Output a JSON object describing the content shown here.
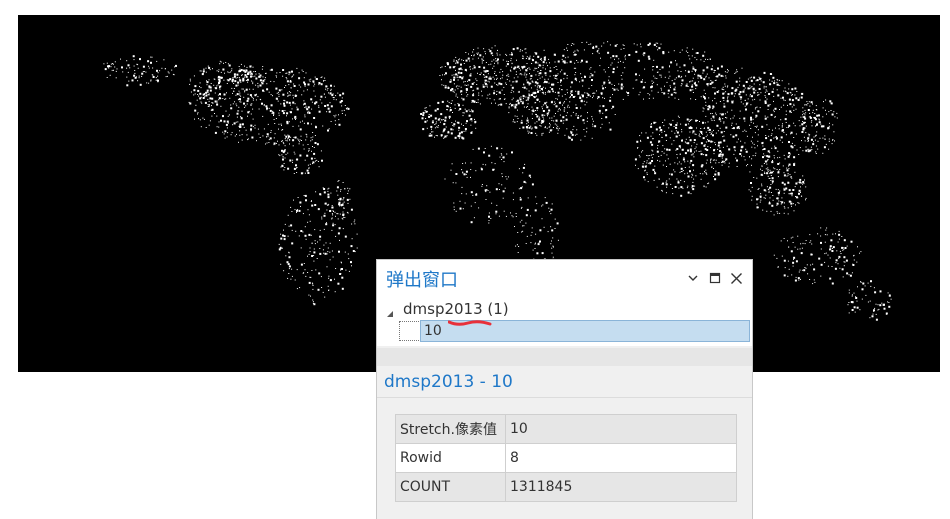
{
  "map": {
    "background": "#000000",
    "lights_color": "#ffffff"
  },
  "popup": {
    "title": "弹出窗口",
    "title_color": "#1f78c8",
    "controls": {
      "dropdown_icon": "chevron-down-icon",
      "maximize_icon": "maximize-icon",
      "close_icon": "close-icon"
    },
    "tree": {
      "layer_label": "dmsp2013  (1)",
      "selected_item": "10",
      "selected_bg": "#c5ddf0"
    },
    "feature_title": "dmsp2013 - 10",
    "attributes": [
      {
        "field": "Stretch.像素值",
        "value": "10"
      },
      {
        "field": "Rowid",
        "value": "8"
      },
      {
        "field": "COUNT",
        "value": "1311845"
      }
    ],
    "annotation_color": "#e8303a"
  }
}
